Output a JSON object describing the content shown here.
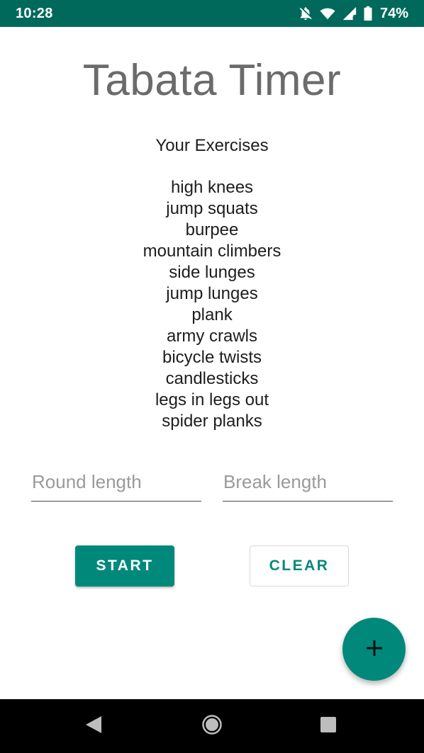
{
  "status_bar": {
    "time": "10:28",
    "battery": "74%",
    "icons": [
      "notifications-off-icon",
      "wifi-icon",
      "signal-icon",
      "battery-icon"
    ],
    "background": "#00695c"
  },
  "app": {
    "title": "Tabata Timer",
    "exercises_heading": "Your Exercises",
    "exercises": [
      "high knees",
      "jump squats",
      "burpee",
      "mountain climbers",
      "side lunges",
      "jump lunges",
      "plank",
      "army crawls",
      "bicycle twists",
      "candlesticks",
      "legs in legs out",
      "spider planks"
    ]
  },
  "inputs": {
    "round_length": {
      "value": "",
      "placeholder": "Round length"
    },
    "break_length": {
      "value": "",
      "placeholder": "Break length"
    }
  },
  "buttons": {
    "start_label": "START",
    "clear_label": "CLEAR"
  },
  "fab": {
    "icon": "plus-icon"
  },
  "nav_bar": {
    "icons": [
      "back-icon",
      "home-icon",
      "recents-icon"
    ]
  },
  "colors": {
    "accent": "#00897b",
    "status_bar": "#00695c",
    "title": "#6b6b6b"
  }
}
